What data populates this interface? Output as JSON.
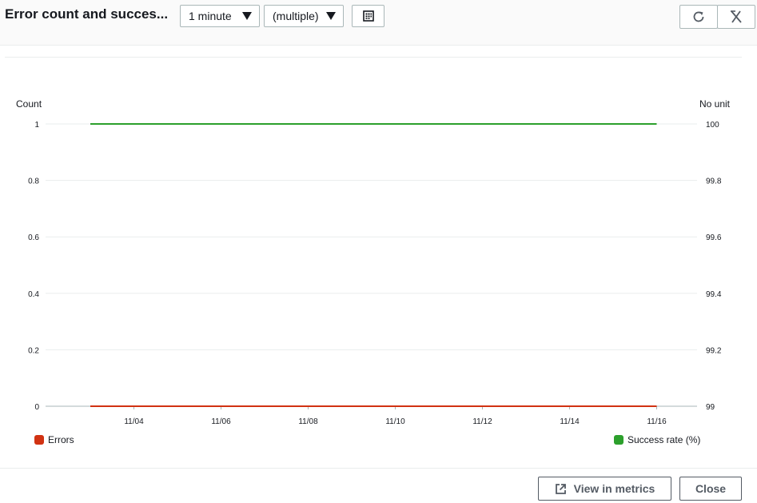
{
  "header": {
    "title": "Error count and succes...",
    "period_value": "1 minute",
    "statistic_value": "(multiple)",
    "calendar_icon": "calendar-grid-icon",
    "refresh_icon": "refresh-icon",
    "collapse_icon": "collapse-icon"
  },
  "chart": {
    "left_axis_title": "Count",
    "right_axis_title": "No unit",
    "legend_errors": "Errors",
    "legend_success": "Success rate (%)"
  },
  "footer": {
    "view_metrics_label": "View in metrics",
    "close_label": "Close",
    "external_link_icon": "external-link-icon"
  },
  "colors": {
    "errors": "#d13212",
    "success": "#2ca02c",
    "border": "#aab7b8"
  },
  "chart_data": {
    "type": "line",
    "x": [
      "11/03",
      "11/04",
      "11/05",
      "11/06",
      "11/07",
      "11/08",
      "11/09",
      "11/10",
      "11/11",
      "11/12",
      "11/13",
      "11/14",
      "11/15",
      "11/16"
    ],
    "x_tick_labels": [
      "11/04",
      "11/06",
      "11/08",
      "11/10",
      "11/12",
      "11/14",
      "11/16"
    ],
    "series": [
      {
        "name": "Errors",
        "axis": "left",
        "values": [
          0,
          0,
          0,
          0,
          0,
          0,
          0,
          0,
          0,
          0,
          0,
          0,
          0,
          0
        ]
      },
      {
        "name": "Success rate (%)",
        "axis": "right",
        "values": [
          100,
          100,
          100,
          100,
          100,
          100,
          100,
          100,
          100,
          100,
          100,
          100,
          100,
          100
        ]
      }
    ],
    "left_axis": {
      "label": "Count",
      "ylim": [
        0,
        1
      ],
      "ticks": [
        "1",
        "0.8",
        "0.6",
        "0.4",
        "0.2",
        "0"
      ]
    },
    "right_axis": {
      "label": "No unit",
      "ylim": [
        99,
        100
      ],
      "ticks": [
        "100",
        "99.8",
        "99.6",
        "99.4",
        "99.2",
        "99"
      ]
    },
    "grid": true,
    "legend": "bottom"
  }
}
